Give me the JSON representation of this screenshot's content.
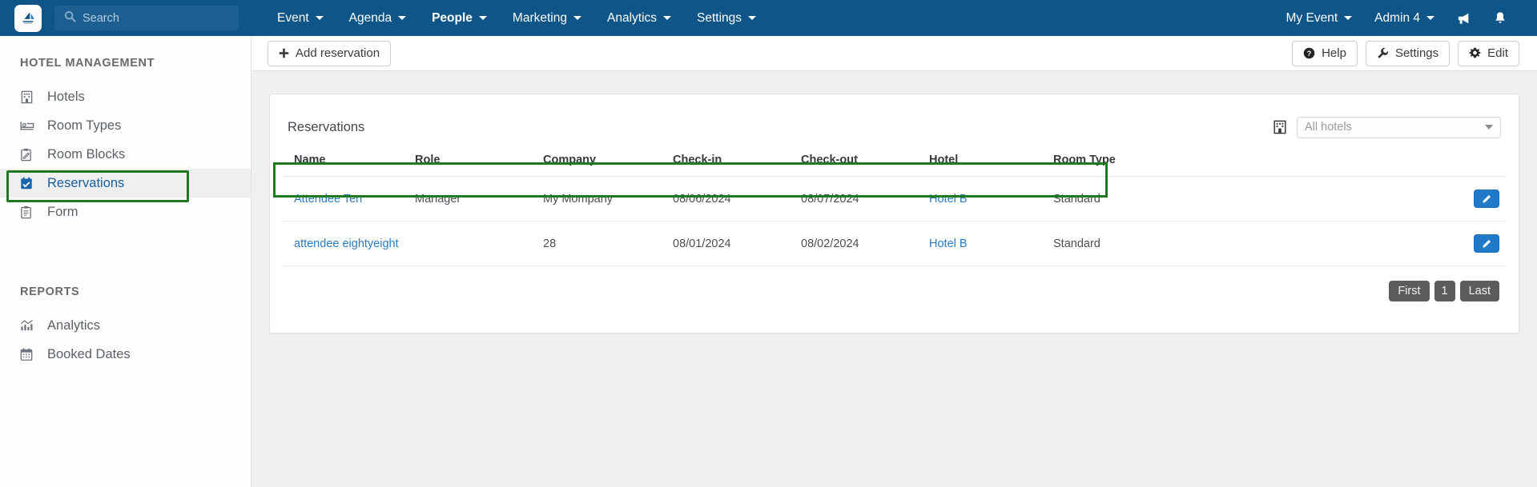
{
  "topnav": {
    "logo_icon": "sail-boat-logo",
    "search": {
      "placeholder": "Search",
      "value": ""
    },
    "items": [
      {
        "label": "Event",
        "active": false
      },
      {
        "label": "Agenda",
        "active": false
      },
      {
        "label": "People",
        "active": true
      },
      {
        "label": "Marketing",
        "active": false
      },
      {
        "label": "Analytics",
        "active": false
      },
      {
        "label": "Settings",
        "active": false
      }
    ],
    "event_menu": "My Event",
    "admin_menu": "Admin 4",
    "announcement_icon": "megaphone-icon",
    "notification_icon": "bell-icon",
    "background": "#0f5587"
  },
  "sidebar": {
    "heading": "HOTEL MANAGEMENT",
    "items": [
      {
        "label": "Hotels",
        "icon": "hotel-building-icon",
        "selected": false
      },
      {
        "label": "Room Types",
        "icon": "bed-icon",
        "selected": false
      },
      {
        "label": "Room Blocks",
        "icon": "clipboard-pencil-icon",
        "selected": false
      },
      {
        "label": "Reservations",
        "icon": "calendar-check-icon",
        "selected": true
      },
      {
        "label": "Form",
        "icon": "clipboard-icon",
        "selected": false
      }
    ],
    "reports_heading": "REPORTS",
    "reports": [
      {
        "label": "Analytics",
        "icon": "bar-chart-icon"
      },
      {
        "label": "Booked Dates",
        "icon": "calendar-icon"
      }
    ]
  },
  "toolbar": {
    "add_label": "Add reservation",
    "add_icon": "plus-icon",
    "help_label": "Help",
    "help_icon": "question-circle-icon",
    "settings_label": "Settings",
    "settings_icon": "wrench-icon",
    "edit_label": "Edit",
    "edit_icon": "gear-icon"
  },
  "card": {
    "title": "Reservations",
    "hotel_filter_icon": "hotel-building-icon",
    "hotel_filter_value": "All hotels",
    "columns": [
      "Name",
      "Role",
      "Company",
      "Check-in",
      "Check-out",
      "Hotel",
      "Room Type"
    ],
    "rows": [
      {
        "name": "Attendee Ten",
        "role": "Manager",
        "company": "My Mompany",
        "checkin": "08/06/2024",
        "checkout": "08/07/2024",
        "hotel": "Hotel B",
        "room_type": "Standard",
        "edit_icon": "pencil-icon"
      },
      {
        "name": "attendee eightyeight",
        "role": "",
        "company": "28",
        "checkin": "08/01/2024",
        "checkout": "08/02/2024",
        "hotel": "Hotel B",
        "room_type": "Standard",
        "edit_icon": "pencil-icon"
      }
    ],
    "pagination": {
      "first": "First",
      "current": "1",
      "last": "Last"
    }
  },
  "annotations": {
    "highlight_color": "#1f7a1f",
    "targets": [
      "sidebar-item-reservations",
      "table-header-row"
    ]
  }
}
